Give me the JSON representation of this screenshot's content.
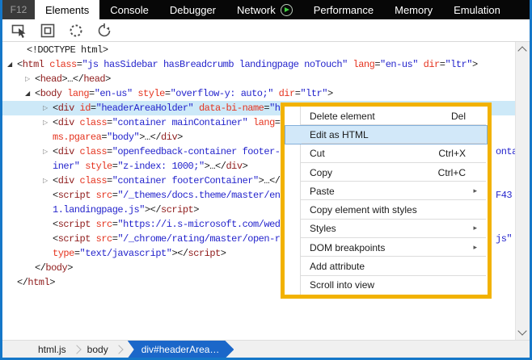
{
  "colors": {
    "accent": "#1577c8",
    "tabbar_bg": "#070707",
    "f12_bg": "#3a3a3a",
    "f12_text": "#9d9d9d",
    "tab_text": "#ffffff",
    "active_tab_bg": "#ffffff",
    "active_tab_text": "#000000",
    "play_green": "#3fd13f",
    "toolbar_sep": "#d9d9d9",
    "icon_gray": "#4d4d4d",
    "code_tag": "#8f1c1c",
    "code_attr": "#e5341f",
    "code_val": "#2424cc",
    "code_punct": "#202020",
    "selection": "#cde9f8",
    "menu_border": "#f2b200",
    "menu_bg": "#ffffff",
    "menu_text": "#1b1b1b",
    "menu_sep": "#dcdcdc",
    "hl_bg": "#d2e8f9",
    "hl_border": "#83afd9",
    "crumb_bar": "#f0f0f0",
    "crumb_blue": "#1b67c9",
    "crumb_text": "#1f1f1f",
    "sep_gray": "#b5b5b5",
    "scroll_track": "#f0f0f0",
    "scroll_arrow": "#5f5f5f"
  },
  "tabs": {
    "f12_label": "F12",
    "items": [
      {
        "label": "Elements",
        "active": true
      },
      {
        "label": "Console"
      },
      {
        "label": "Debugger"
      },
      {
        "label": "Network",
        "icon": "play"
      },
      {
        "label": "Performance"
      },
      {
        "label": "Memory"
      },
      {
        "label": "Emulation"
      }
    ]
  },
  "toolbar": {
    "icons": [
      "select-element",
      "element-highlighting",
      "dashed-circle",
      "refresh-timer"
    ]
  },
  "code": {
    "lines": [
      {
        "x": 30,
        "arrow": null,
        "parts": [
          [
            "doc",
            "<!DOCTYPE html>"
          ]
        ]
      },
      {
        "x": 18,
        "arrow": "open",
        "parts": [
          [
            "p",
            "<"
          ],
          [
            "tag",
            "html"
          ],
          [
            "p",
            " "
          ],
          [
            "attr",
            "class"
          ],
          [
            "p",
            "="
          ],
          [
            "val",
            "\"js hasSidebar hasBreadcrumb landingpage noTouch\""
          ],
          [
            "p",
            " "
          ],
          [
            "attr",
            "lang"
          ],
          [
            "p",
            "="
          ],
          [
            "val",
            "\"en-us\""
          ],
          [
            "p",
            " "
          ],
          [
            "attr",
            "dir"
          ],
          [
            "p",
            "="
          ],
          [
            "val",
            "\"ltr\""
          ],
          [
            "p",
            ">"
          ]
        ]
      },
      {
        "x": 40,
        "arrow": "closed",
        "parts": [
          [
            "p",
            "<"
          ],
          [
            "tag",
            "head"
          ],
          [
            "p",
            ">…</"
          ],
          [
            "tag",
            "head"
          ],
          [
            "p",
            ">"
          ]
        ]
      },
      {
        "x": 40,
        "arrow": "open",
        "parts": [
          [
            "p",
            "<"
          ],
          [
            "tag",
            "body"
          ],
          [
            "p",
            " "
          ],
          [
            "attr",
            "lang"
          ],
          [
            "p",
            "="
          ],
          [
            "val",
            "\"en-us\""
          ],
          [
            "p",
            " "
          ],
          [
            "attr",
            "style"
          ],
          [
            "p",
            "="
          ],
          [
            "val",
            "\"overflow-y: auto;\""
          ],
          [
            "p",
            " "
          ],
          [
            "attr",
            "dir"
          ],
          [
            "p",
            "="
          ],
          [
            "val",
            "\"ltr\""
          ],
          [
            "p",
            ">"
          ]
        ]
      },
      {
        "x": 62,
        "arrow": "closed",
        "selected": true,
        "parts": [
          [
            "p",
            "<"
          ],
          [
            "tag",
            "div"
          ],
          [
            "p",
            " "
          ],
          [
            "attr",
            "id"
          ],
          [
            "p",
            "="
          ],
          [
            "val",
            "\"headerAreaHolder\""
          ],
          [
            "p",
            " "
          ],
          [
            "attr",
            "data-bi-name"
          ],
          [
            "p",
            "="
          ],
          [
            "val",
            "\"he"
          ]
        ]
      },
      {
        "x": 62,
        "arrow": "closed",
        "parts": [
          [
            "p",
            "<"
          ],
          [
            "tag",
            "div"
          ],
          [
            "p",
            " "
          ],
          [
            "attr",
            "class"
          ],
          [
            "p",
            "="
          ],
          [
            "val",
            "\"container mainContainer\""
          ],
          [
            "p",
            " "
          ],
          [
            "attr",
            "lang"
          ],
          [
            "p",
            "="
          ]
        ]
      },
      {
        "x": 62,
        "arrow": null,
        "parts": [
          [
            "attr",
            "ms.pgarea"
          ],
          [
            "p",
            "="
          ],
          [
            "val",
            "\"body\""
          ],
          [
            "p",
            ">…</"
          ],
          [
            "tag",
            "div"
          ],
          [
            "p",
            ">"
          ]
        ]
      },
      {
        "x": 62,
        "arrow": "closed",
        "frag": "onta",
        "parts": [
          [
            "p",
            "<"
          ],
          [
            "tag",
            "div"
          ],
          [
            "p",
            " "
          ],
          [
            "attr",
            "class"
          ],
          [
            "p",
            "="
          ],
          [
            "val",
            "\"openfeedback-container footer-c"
          ]
        ]
      },
      {
        "x": 62,
        "arrow": null,
        "parts": [
          [
            "val",
            "iner\""
          ],
          [
            "p",
            " "
          ],
          [
            "attr",
            "style"
          ],
          [
            "p",
            "="
          ],
          [
            "val",
            "\"z-index: 1000;\""
          ],
          [
            "p",
            ">…</"
          ],
          [
            "tag",
            "div"
          ],
          [
            "p",
            ">"
          ]
        ]
      },
      {
        "x": 62,
        "arrow": "closed",
        "parts": [
          [
            "p",
            "<"
          ],
          [
            "tag",
            "div"
          ],
          [
            "p",
            " "
          ],
          [
            "attr",
            "class"
          ],
          [
            "p",
            "="
          ],
          [
            "val",
            "\"container footerContainer\""
          ],
          [
            "p",
            ">…</"
          ],
          [
            "tag",
            "div"
          ],
          [
            "p",
            ">"
          ]
        ]
      },
      {
        "x": 62,
        "arrow": null,
        "frag": "F43",
        "parts": [
          [
            "p",
            "<"
          ],
          [
            "tag",
            "script"
          ],
          [
            "p",
            " "
          ],
          [
            "attr",
            "src"
          ],
          [
            "p",
            "="
          ],
          [
            "val",
            "\"/_themes/docs.theme/master/en"
          ]
        ]
      },
      {
        "x": 62,
        "arrow": null,
        "parts": [
          [
            "val",
            "1.landingpage.js\""
          ],
          [
            "p",
            "></"
          ],
          [
            "tag",
            "script"
          ],
          [
            "p",
            ">"
          ]
        ]
      },
      {
        "x": 62,
        "arrow": null,
        "parts": [
          [
            "p",
            "<"
          ],
          [
            "tag",
            "script"
          ],
          [
            "p",
            " "
          ],
          [
            "attr",
            "src"
          ],
          [
            "p",
            "="
          ],
          [
            "val",
            "\"https://i.s-microsoft.com/wed"
          ]
        ]
      },
      {
        "x": 62,
        "arrow": null,
        "frag": "js\"",
        "parts": [
          [
            "p",
            "<"
          ],
          [
            "tag",
            "script"
          ],
          [
            "p",
            " "
          ],
          [
            "attr",
            "src"
          ],
          [
            "p",
            "="
          ],
          [
            "val",
            "\"/_chrome/rating/master/open-r"
          ]
        ]
      },
      {
        "x": 62,
        "arrow": null,
        "parts": [
          [
            "attr",
            "type"
          ],
          [
            "p",
            "="
          ],
          [
            "val",
            "\"text/javascript\""
          ],
          [
            "p",
            "></"
          ],
          [
            "tag",
            "script"
          ],
          [
            "p",
            ">"
          ]
        ]
      },
      {
        "x": 40,
        "arrow": null,
        "parts": [
          [
            "p",
            "</"
          ],
          [
            "tag",
            "body"
          ],
          [
            "p",
            ">"
          ]
        ]
      },
      {
        "x": 18,
        "arrow": null,
        "parts": [
          [
            "p",
            "</"
          ],
          [
            "tag",
            "html"
          ],
          [
            "p",
            ">"
          ]
        ]
      }
    ]
  },
  "menu": {
    "items": [
      {
        "label": "Delete element",
        "shortcut": "Del"
      },
      {
        "label": "Edit as HTML",
        "highlight": true
      },
      {
        "label": "Cut",
        "shortcut": "Ctrl+X"
      },
      {
        "label": "Copy",
        "shortcut": "Ctrl+C"
      },
      {
        "label": "Paste",
        "submenu": true
      },
      {
        "label": "Copy element with styles"
      },
      {
        "label": "Styles",
        "submenu": true
      },
      {
        "label": "DOM breakpoints",
        "submenu": true
      },
      {
        "label": "Add attribute"
      },
      {
        "label": "Scroll into view"
      }
    ]
  },
  "breadcrumb": {
    "items": [
      {
        "label": "html.js"
      },
      {
        "label": "body"
      },
      {
        "label": "div#headerArea…",
        "active": true
      }
    ]
  }
}
